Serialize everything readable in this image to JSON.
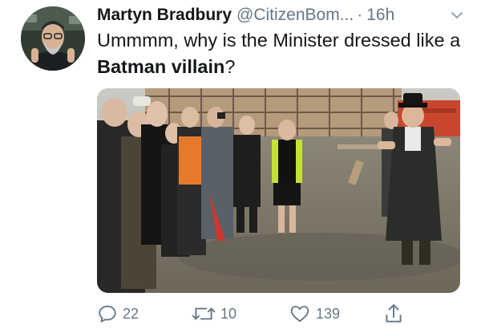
{
  "tweet": {
    "author_name": "Martyn Bradbury",
    "handle": "@CitizenBom...",
    "separator": "·",
    "time": "16h",
    "text_plain": "Ummmm, why is the Minister dressed like a ",
    "text_bold": "Batman villain",
    "text_end": "?",
    "avatar_icon": "profile-photo",
    "menu_icon": "chevron-down-icon"
  },
  "media": {
    "description_icon": "photo-image"
  },
  "actions": {
    "reply": {
      "icon": "reply-icon",
      "count": "22"
    },
    "retweet": {
      "icon": "retweet-icon",
      "count": "10"
    },
    "like": {
      "icon": "heart-icon",
      "count": "139"
    },
    "share": {
      "icon": "share-icon"
    }
  },
  "colors": {
    "text": "#14171a",
    "muted": "#657786",
    "background": "#ffffff"
  }
}
